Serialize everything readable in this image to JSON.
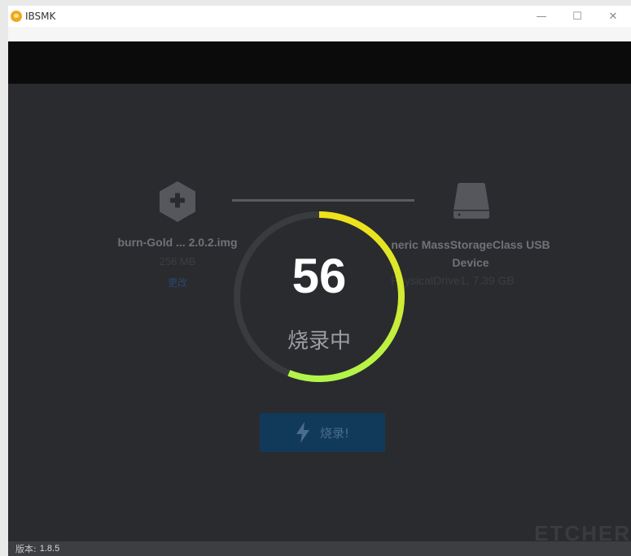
{
  "window": {
    "title": "IBSMK",
    "controls": {
      "minimize": "—",
      "maximize": "☐",
      "close": "✕"
    }
  },
  "image": {
    "name": "burn-Gold ... 2.0.2.img",
    "size": "256 MB",
    "change_label": "更改",
    "icon": "plus-hex-icon"
  },
  "drive": {
    "name_line1": "neric MassStorageClass USB",
    "name_line2": "Device",
    "detail": "PhysicalDrive1, 7.39 GB",
    "icon": "drive-icon"
  },
  "progress": {
    "percent": 56,
    "percent_text": "56",
    "status": "烧录中"
  },
  "flash_button": {
    "label": "烧录!",
    "icon": "lightning-icon"
  },
  "footer": {
    "version_label": "版本:",
    "version_value": "1.8.5",
    "brand": "ETCHER"
  },
  "colors": {
    "background": "#2a2b2e",
    "progress_start": "#f0e11a",
    "progress_end": "#b2f54a",
    "button": "#113a5a"
  }
}
